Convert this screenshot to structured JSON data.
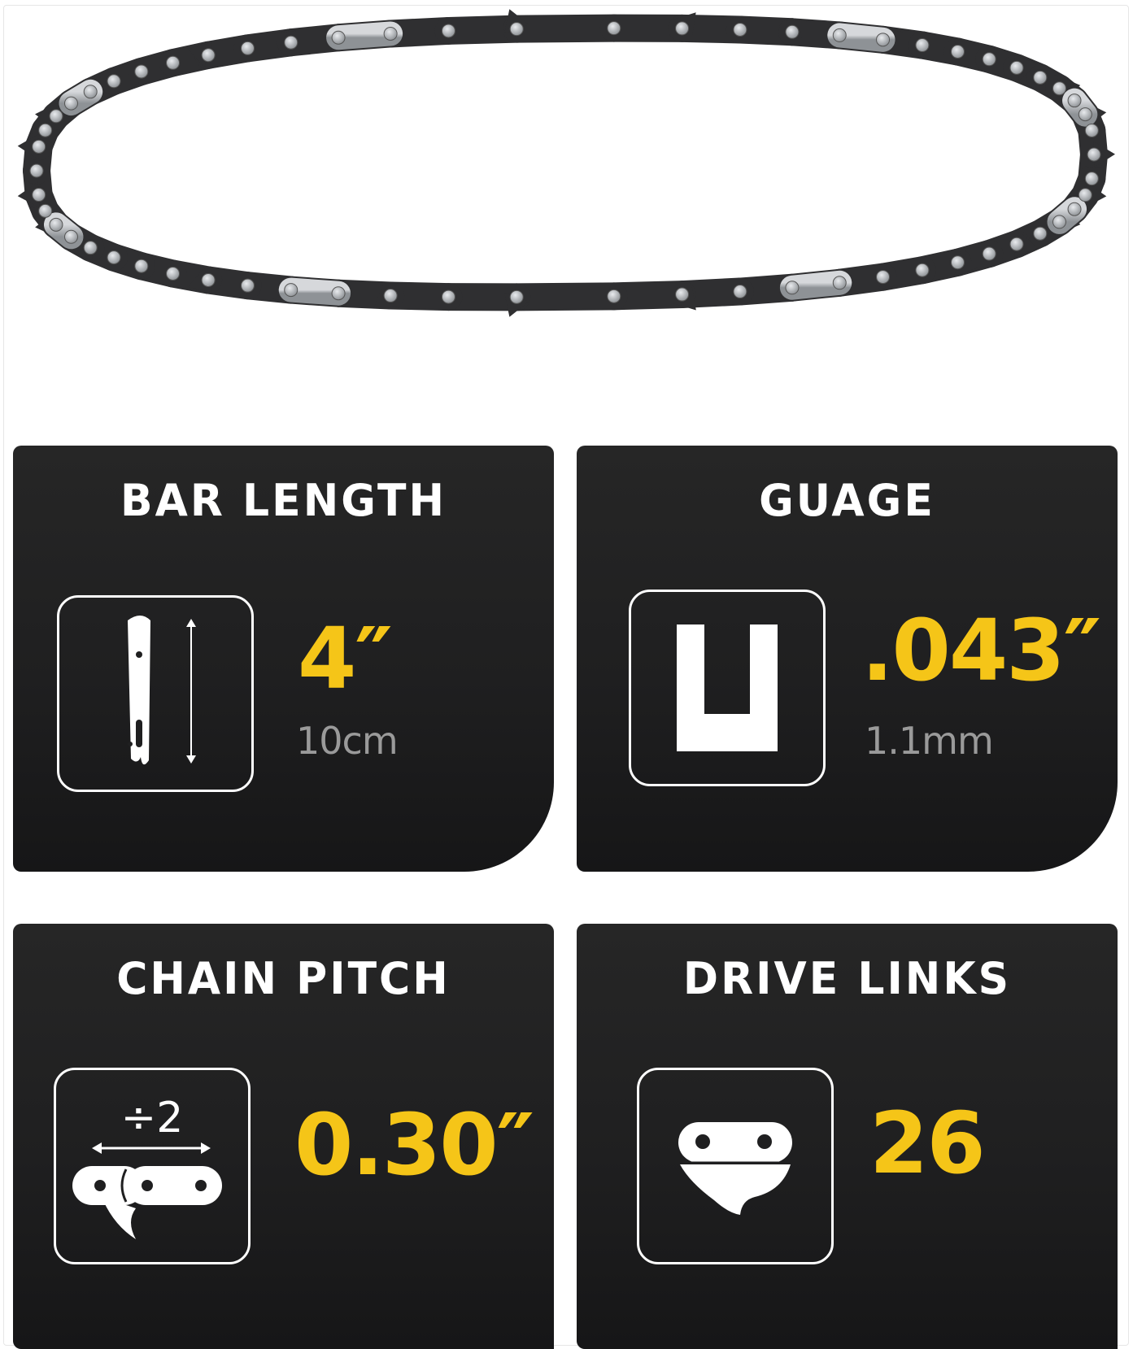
{
  "specs": [
    {
      "title": "BAR LENGTH",
      "value": "4″",
      "subvalue": "10cm",
      "icon": "guide-bar-icon"
    },
    {
      "title": "GUAGE",
      "value": ".043″",
      "subvalue": "1.1mm",
      "icon": "gauge-u-icon"
    },
    {
      "title": "CHAIN PITCH",
      "value": "0.30″",
      "icon": "chain-pitch-icon",
      "icon_label": "÷2"
    },
    {
      "title": "DRIVE LINKS",
      "value": "26",
      "icon": "drive-link-icon"
    }
  ],
  "colors": {
    "card_bg": "#1f1f20",
    "accent": "#f5c518",
    "subtext": "#9a9a9a",
    "chain_dark": "#2f2f31",
    "chain_silver": "#b9bcc0"
  }
}
